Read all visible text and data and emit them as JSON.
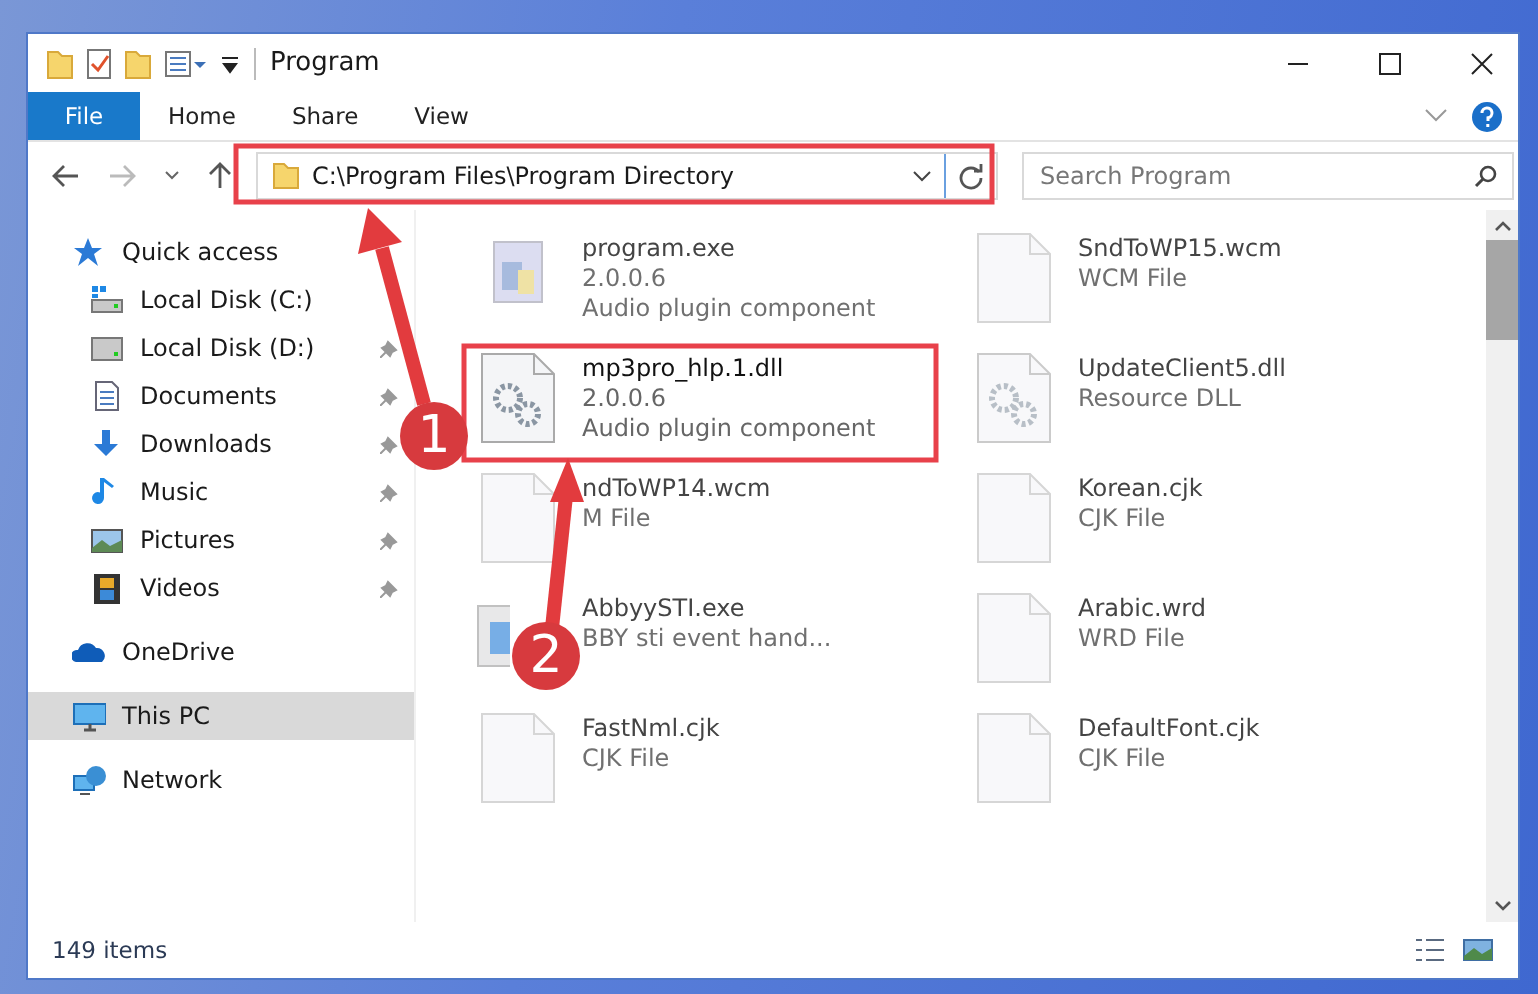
{
  "window": {
    "title": "Program"
  },
  "ribbon_tabs": [
    {
      "label": "File",
      "kind": "menu",
      "selected": false
    },
    {
      "label": "Home",
      "kind": "tab",
      "selected": false
    },
    {
      "label": "Share",
      "kind": "tab",
      "selected": false
    },
    {
      "label": "View",
      "kind": "tab",
      "selected": false
    }
  ],
  "address_bar": {
    "path": "C:\\Program Files\\Program Directory",
    "highlighted": true
  },
  "search": {
    "placeholder": "Search Program"
  },
  "sidebar": {
    "items": [
      {
        "label": "Quick access",
        "kind": "star",
        "selected": false,
        "children": [
          {
            "label": "Local Disk (C:)",
            "kind": "drive-c",
            "pinned": false,
            "selected": false
          },
          {
            "label": "Local Disk (D:)",
            "kind": "drive",
            "pinned": true,
            "selected": false
          },
          {
            "label": "Documents",
            "kind": "documents",
            "pinned": true,
            "selected": false
          },
          {
            "label": "Downloads",
            "kind": "downloads",
            "pinned": true,
            "selected": false
          },
          {
            "label": "Music",
            "kind": "music",
            "pinned": true,
            "selected": false
          },
          {
            "label": "Pictures",
            "kind": "pictures",
            "pinned": true,
            "selected": false
          },
          {
            "label": "Videos",
            "kind": "videos",
            "pinned": true,
            "selected": false
          }
        ]
      },
      {
        "label": "OneDrive",
        "kind": "cloud",
        "selected": false
      },
      {
        "label": "This PC",
        "kind": "pc",
        "selected": true
      },
      {
        "label": "Network",
        "kind": "network",
        "selected": false
      }
    ]
  },
  "files": [
    {
      "name": "program.exe",
      "details": [
        "2.0.0.6",
        "Audio plugin component"
      ],
      "kind": "exe",
      "blurred": true,
      "highlighted": false
    },
    {
      "name": "SndToWP15.wcm",
      "details": [
        "WCM File"
      ],
      "kind": "blank",
      "blurred": true,
      "highlighted": false
    },
    {
      "name": "mp3pro_hlp.1.dll",
      "details": [
        "2.0.0.6",
        "Audio plugin component"
      ],
      "kind": "gear",
      "blurred": false,
      "highlighted": true
    },
    {
      "name": "UpdateClient5.dll",
      "details": [
        "Resource DLL"
      ],
      "kind": "gear",
      "blurred": true,
      "highlighted": false
    },
    {
      "name": "ndToWP14.wcm",
      "details": [
        "M File"
      ],
      "kind": "blank",
      "blurred": true,
      "highlighted": false
    },
    {
      "name": "Korean.cjk",
      "details": [
        "CJK File"
      ],
      "kind": "blank",
      "blurred": true,
      "highlighted": false
    },
    {
      "name": "AbbyySTI.exe",
      "details": [
        "BBY sti event hand..."
      ],
      "kind": "app",
      "blurred": true,
      "highlighted": false
    },
    {
      "name": "Arabic.wrd",
      "details": [
        "WRD File"
      ],
      "kind": "blank",
      "blurred": true,
      "highlighted": false
    },
    {
      "name": "FastNml.cjk",
      "details": [
        "CJK File"
      ],
      "kind": "blank",
      "blurred": true,
      "highlighted": false
    },
    {
      "name": "DefaultFont.cjk",
      "details": [
        "CJK File"
      ],
      "kind": "blank",
      "blurred": true,
      "highlighted": false
    }
  ],
  "status_bar": {
    "count": "149 items"
  },
  "callouts": [
    {
      "number": "1"
    },
    {
      "number": "2"
    }
  ]
}
